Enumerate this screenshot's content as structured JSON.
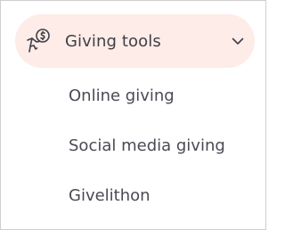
{
  "menu": {
    "section_label": "Giving tools",
    "section_icon": "hand-coin-icon",
    "toggle_icon": "chevron-down-icon",
    "expanded": true,
    "items": [
      {
        "label": "Online giving"
      },
      {
        "label": "Social media giving"
      },
      {
        "label": "Givelithon"
      }
    ]
  },
  "colors": {
    "header_background": "#fdece7",
    "text": "#4a4a54",
    "border": "#cfcfcf"
  }
}
